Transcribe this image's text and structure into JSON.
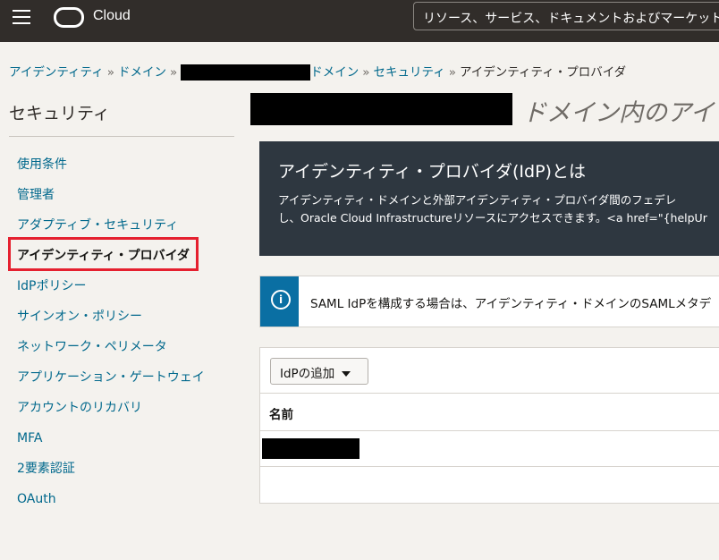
{
  "header": {
    "brand": "Cloud",
    "search_text": "リソース、サービス、ドキュメントおよびマーケットプレイスの検索"
  },
  "breadcrumb": {
    "items": [
      "アイデンティティ",
      "ドメイン",
      "ドメイン",
      "セキュリティ"
    ],
    "current": "アイデンティティ・プロバイダ",
    "separator": "»"
  },
  "sidebar": {
    "title": "セキュリティ",
    "items": [
      {
        "label": "使用条件"
      },
      {
        "label": "管理者"
      },
      {
        "label": "アダプティブ・セキュリティ"
      },
      {
        "label": "アイデンティティ・プロバイダ"
      },
      {
        "label": "IdPポリシー"
      },
      {
        "label": "サインオン・ポリシー"
      },
      {
        "label": "ネットワーク・ペリメータ"
      },
      {
        "label": "アプリケーション・ゲートウェイ"
      },
      {
        "label": "アカウントのリカバリ"
      },
      {
        "label": "MFA"
      },
      {
        "label": "2要素認証"
      },
      {
        "label": "OAuth"
      }
    ]
  },
  "main": {
    "title": "ドメイン内のアイ",
    "info_panel": {
      "heading": "アイデンティティ・プロバイダ(IdP)とは",
      "line1": "アイデンティティ・ドメインと外部アイデンティティ・プロバイダ間のフェデレ",
      "line2": "し、Oracle Cloud Infrastructureリソースにアクセスできます。<a href=\"{helpUr"
    },
    "notice": {
      "text": "SAML IdPを構成する場合は、アイデンティティ・ドメインのSAMLメタデ"
    },
    "table": {
      "add_button": "IdPの追加",
      "column_name": "名前"
    }
  },
  "colors": {
    "header_bg": "#312d2a",
    "link": "#00688c",
    "info_panel_bg": "#2e3740",
    "notice_accent": "#0a6fa3",
    "highlight": "#e5202f"
  }
}
